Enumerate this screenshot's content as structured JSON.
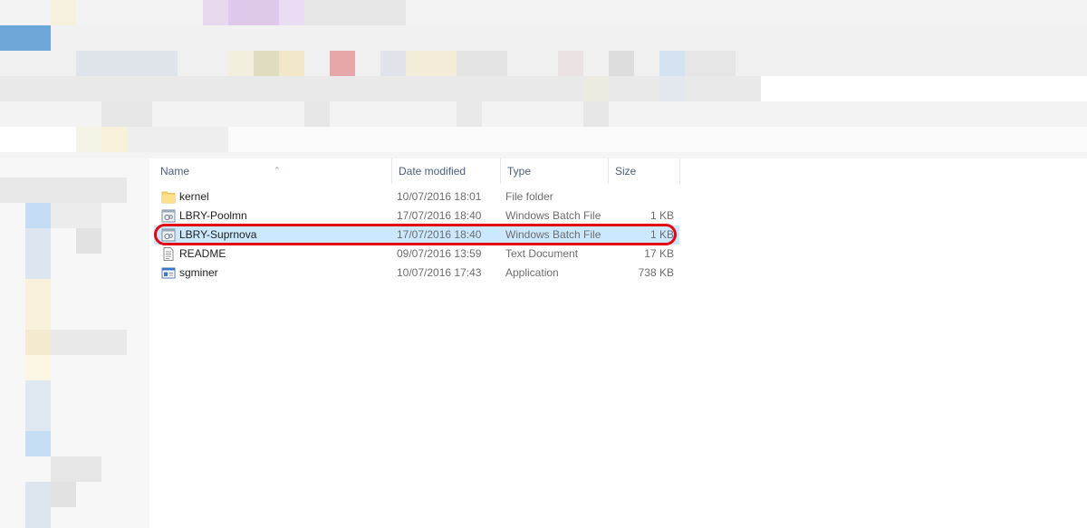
{
  "columns": {
    "name": "Name",
    "date": "Date modified",
    "type": "Type",
    "size": "Size"
  },
  "files": [
    {
      "name": "kernel",
      "date": "10/07/2016 18:01",
      "type": "File folder",
      "size": "",
      "icon": "folder-icon"
    },
    {
      "name": "LBRY-Poolmn",
      "date": "17/07/2016 18:40",
      "type": "Windows Batch File",
      "size": "1 KB",
      "icon": "batch-file-icon"
    },
    {
      "name": "LBRY-Suprnova",
      "date": "17/07/2016 18:40",
      "type": "Windows Batch File",
      "size": "1 KB",
      "icon": "batch-file-icon",
      "selected": true
    },
    {
      "name": "README",
      "date": "09/07/2016 13:59",
      "type": "Text Document",
      "size": "17 KB",
      "icon": "text-document-icon"
    },
    {
      "name": "sgminer",
      "date": "10/07/2016 17:43",
      "type": "Application",
      "size": "738 KB",
      "icon": "application-icon"
    }
  ],
  "colors": {
    "selection": "#cce8ff",
    "highlight_ring": "#e30613",
    "header_text": "#4c607a"
  }
}
